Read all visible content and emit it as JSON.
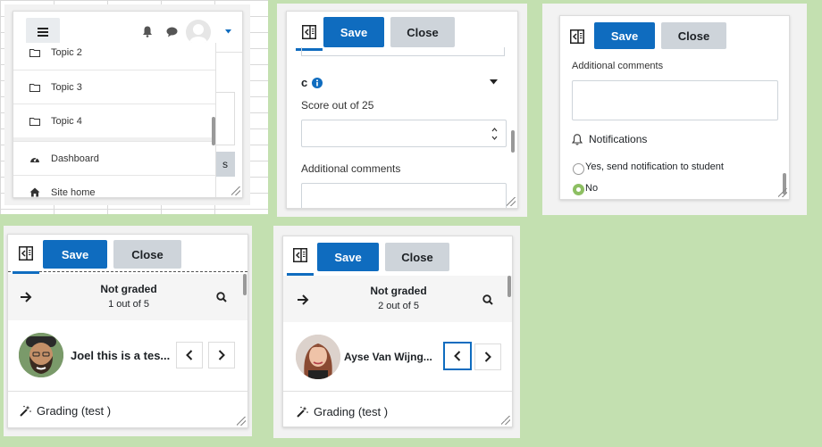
{
  "nav_drawer": {
    "items": [
      {
        "label": "Topic 2",
        "icon": "folder-icon"
      },
      {
        "label": "Topic 3",
        "icon": "folder-icon"
      },
      {
        "label": "Topic 4",
        "icon": "folder-icon"
      },
      {
        "label": "Dashboard",
        "icon": "dashboard-icon"
      },
      {
        "label": "Site home",
        "icon": "home-icon"
      }
    ],
    "partial_button_text": "s"
  },
  "grade_panel_score": {
    "save_label": "Save",
    "close_label": "Close",
    "criterion_label": "c",
    "score_label": "Score out of 25",
    "comments_label": "Additional comments"
  },
  "grade_panel_notify": {
    "save_label": "Save",
    "close_label": "Close",
    "comments_label": "Additional comments",
    "notifications_label": "Notifications",
    "option_yes": "Yes, send notification to student",
    "option_no": "No",
    "selected_option": "No"
  },
  "grader_1": {
    "save_label": "Save",
    "close_label": "Close",
    "status": "Not graded",
    "position": "1 out of 5",
    "user_name": "Joel this is a tes...",
    "grading_label": "Grading (test )"
  },
  "grader_2": {
    "save_label": "Save",
    "close_label": "Close",
    "status": "Not graded",
    "position": "2 out of 5",
    "user_name": "Ayse Van Wijng...",
    "grading_label": "Grading (test )"
  },
  "colors": {
    "primary": "#0f6cbf",
    "secondary": "#ced4da",
    "page_background": "#c3e0b0",
    "radio_selected": "#8dbf62"
  }
}
